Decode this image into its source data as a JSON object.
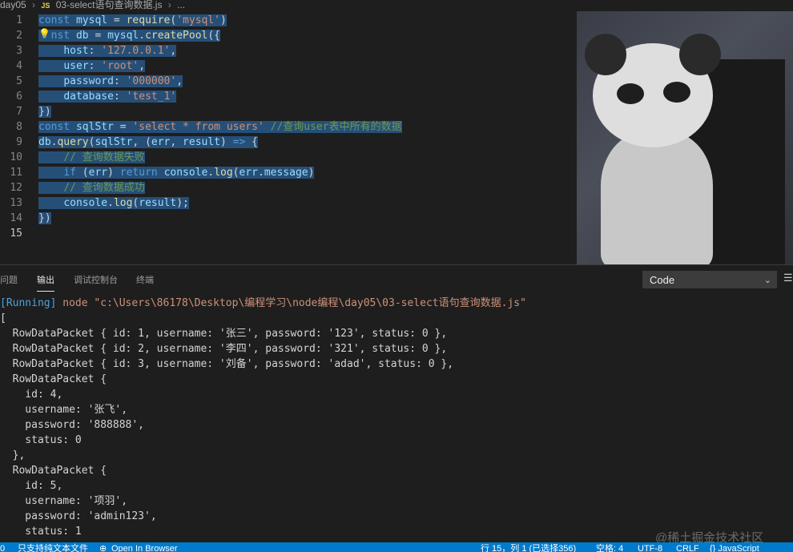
{
  "breadcrumb": {
    "folder": "day05",
    "lang_badge": "JS",
    "file": "03-select语句查询数据.js",
    "ellipsis": "..."
  },
  "editor": {
    "line_numbers": [
      "1",
      "2",
      "3",
      "4",
      "5",
      "6",
      "7",
      "8",
      "9",
      "10",
      "11",
      "12",
      "13",
      "14",
      "15"
    ],
    "lines": [
      [
        [
          "kw",
          "const"
        ],
        [
          "op",
          " "
        ],
        [
          "var",
          "mysql"
        ],
        [
          "op",
          " = "
        ],
        [
          "fn",
          "require"
        ],
        [
          "op",
          "("
        ],
        [
          "str",
          "'mysql'"
        ],
        [
          "op",
          ")"
        ]
      ],
      [
        [
          "kw",
          "  nst"
        ],
        [
          "op",
          " "
        ],
        [
          "var",
          "db"
        ],
        [
          "op",
          " = "
        ],
        [
          "var",
          "mysql"
        ],
        [
          "op",
          "."
        ],
        [
          "fn",
          "createPool"
        ],
        [
          "op",
          "({"
        ]
      ],
      [
        [
          "op",
          "    "
        ],
        [
          "var",
          "host"
        ],
        [
          "op",
          ": "
        ],
        [
          "str",
          "'127.0.0.1'"
        ],
        [
          "op",
          ","
        ]
      ],
      [
        [
          "op",
          "    "
        ],
        [
          "var",
          "user"
        ],
        [
          "op",
          ": "
        ],
        [
          "str",
          "'root'"
        ],
        [
          "op",
          ","
        ]
      ],
      [
        [
          "op",
          "    "
        ],
        [
          "var",
          "password"
        ],
        [
          "op",
          ": "
        ],
        [
          "str",
          "'000000'"
        ],
        [
          "op",
          ","
        ]
      ],
      [
        [
          "op",
          "    "
        ],
        [
          "var",
          "database"
        ],
        [
          "op",
          ": "
        ],
        [
          "str",
          "'test_1'"
        ]
      ],
      [
        [
          "op",
          "})"
        ]
      ],
      [
        [
          "kw",
          "const"
        ],
        [
          "op",
          " "
        ],
        [
          "var",
          "sqlStr"
        ],
        [
          "op",
          " = "
        ],
        [
          "str",
          "'select * from users'"
        ],
        [
          "op",
          " "
        ],
        [
          "cm",
          "//查询user表中所有的数据"
        ]
      ],
      [
        [
          "var",
          "db"
        ],
        [
          "op",
          "."
        ],
        [
          "fn",
          "query"
        ],
        [
          "op",
          "("
        ],
        [
          "var",
          "sqlStr"
        ],
        [
          "op",
          ", ("
        ],
        [
          "var",
          "err"
        ],
        [
          "op",
          ", "
        ],
        [
          "var",
          "result"
        ],
        [
          "op",
          ") "
        ],
        [
          "kw",
          "=>"
        ],
        [
          "op",
          " {"
        ]
      ],
      [
        [
          "op",
          "    "
        ],
        [
          "cm",
          "// 查询数据失败"
        ]
      ],
      [
        [
          "op",
          "    "
        ],
        [
          "kw",
          "if"
        ],
        [
          "op",
          " ("
        ],
        [
          "var",
          "err"
        ],
        [
          "op",
          ") "
        ],
        [
          "kw",
          "return"
        ],
        [
          "op",
          " "
        ],
        [
          "var",
          "console"
        ],
        [
          "op",
          "."
        ],
        [
          "fn",
          "log"
        ],
        [
          "op",
          "("
        ],
        [
          "var",
          "err"
        ],
        [
          "op",
          "."
        ],
        [
          "var",
          "message"
        ],
        [
          "op",
          ")"
        ]
      ],
      [
        [
          "op",
          "    "
        ],
        [
          "cm",
          "// 查询数据成功"
        ]
      ],
      [
        [
          "op",
          "    "
        ],
        [
          "var",
          "console"
        ],
        [
          "op",
          "."
        ],
        [
          "fn",
          "log"
        ],
        [
          "op",
          "("
        ],
        [
          "var",
          "result"
        ],
        [
          "op",
          ");"
        ]
      ],
      [
        [
          "op",
          "})"
        ]
      ],
      [
        [
          "op",
          ""
        ]
      ]
    ]
  },
  "panel": {
    "tabs": [
      "问题",
      "输出",
      "调试控制台",
      "终端"
    ],
    "active_tab": "输出",
    "output_channel": "Code",
    "output_lines": [
      "[Running] node \"c:\\Users\\86178\\Desktop\\编程学习\\node编程\\day05\\03-select语句查询数据.js\"",
      "[",
      "  RowDataPacket { id: 1, username: '张三', password: '123', status: 0 },",
      "  RowDataPacket { id: 2, username: '李四', password: '321', status: 0 },",
      "  RowDataPacket { id: 3, username: '刘备', password: 'adad', status: 0 },",
      "  RowDataPacket {",
      "    id: 4,",
      "    username: '张飞',",
      "    password: '888888',",
      "    status: 0",
      "  },",
      "  RowDataPacket {",
      "    id: 5,",
      "    username: '项羽',",
      "    password: 'admin123',",
      "    status: 1"
    ]
  },
  "watermark": "@稀土掘金技术社区",
  "statusbar": {
    "left_count": "0",
    "unsupported": "只支持纯文本文件",
    "open_in_browser": "Open In Browser",
    "cursor": "行 15，列 1 (已选择356)",
    "indent": "空格: 4",
    "encoding": "UTF-8",
    "eol": "CRLF",
    "language": "{} JavaScript"
  },
  "colors": {
    "editor_bg": "#1e1e1e",
    "selection": "#264f78",
    "keyword": "#569cd6",
    "string": "#ce9178",
    "comment": "#6a9955",
    "statusbar": "#007acc"
  }
}
